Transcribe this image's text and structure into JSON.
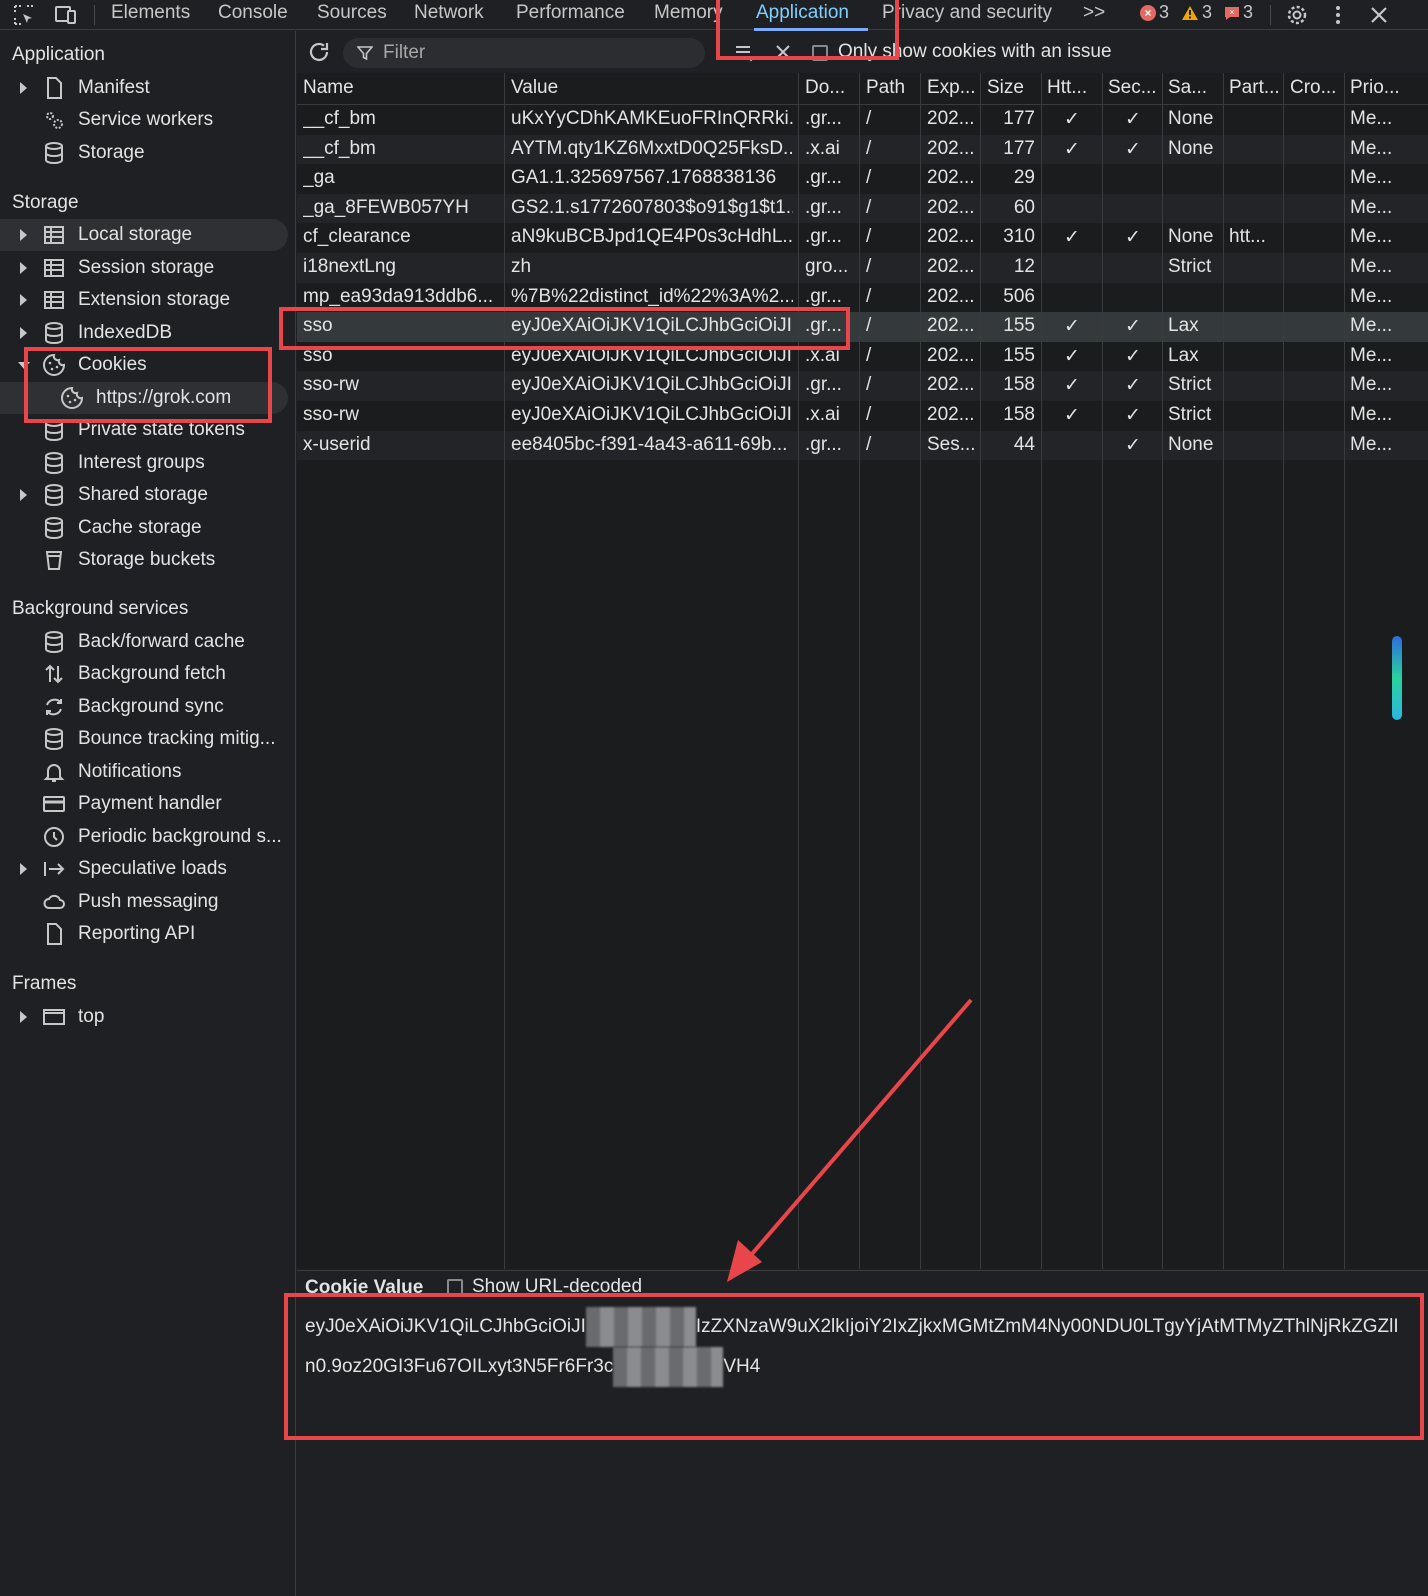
{
  "topbar": {
    "tabs": [
      "Elements",
      "Console",
      "Sources",
      "Network",
      "Performance",
      "Memory",
      "Application",
      "Privacy and security"
    ],
    "active_tab": "Application",
    "more": ">>",
    "errors": "3",
    "warnings": "3",
    "issues": "3"
  },
  "sidebar": {
    "application_header": "Application",
    "application_items": [
      "Manifest",
      "Service workers",
      "Storage"
    ],
    "storage_header": "Storage",
    "storage_items": [
      "Local storage",
      "Session storage",
      "Extension storage",
      "IndexedDB",
      "Cookies",
      "https://grok.com",
      "Private state tokens",
      "Interest groups",
      "Shared storage",
      "Cache storage",
      "Storage buckets"
    ],
    "background_header": "Background services",
    "background_items": [
      "Back/forward cache",
      "Background fetch",
      "Background sync",
      "Bounce tracking mitig...",
      "Notifications",
      "Payment handler",
      "Periodic background s...",
      "Speculative loads",
      "Push messaging",
      "Reporting API"
    ],
    "frames_header": "Frames",
    "frames_items": [
      "top"
    ]
  },
  "toolbar": {
    "filter_placeholder": "Filter",
    "only_issues_label": "Only show cookies with an issue"
  },
  "table": {
    "columns": [
      "Name",
      "Value",
      "Do...",
      "Path",
      "Exp...",
      "Size",
      "Htt...",
      "Sec...",
      "Sa...",
      "Part...",
      "Cro...",
      "Prio..."
    ],
    "rows": [
      [
        "__cf_bm",
        "uKxYyCDhKAMKEuoFRInQRRki...",
        ".gr...",
        "/",
        "202...",
        "177",
        "✓",
        "✓",
        "None",
        "",
        "",
        "Me..."
      ],
      [
        "__cf_bm",
        "AYTM.qty1KZ6MxxtD0Q25FksD...",
        ".x.ai",
        "/",
        "202...",
        "177",
        "✓",
        "✓",
        "None",
        "",
        "",
        "Me..."
      ],
      [
        "_ga",
        "GA1.1.325697567.1768838136",
        ".gr...",
        "/",
        "202...",
        "29",
        "",
        "",
        "",
        "",
        "",
        "Me..."
      ],
      [
        "_ga_8FEWB057YH",
        "GS2.1.s1772607803$o91$g1$t1...",
        ".gr...",
        "/",
        "202...",
        "60",
        "",
        "",
        "",
        "",
        "",
        "Me..."
      ],
      [
        "cf_clearance",
        "aN9kuBCBJpd1QE4P0s3cHdhL...",
        ".gr...",
        "/",
        "202...",
        "310",
        "✓",
        "✓",
        "None",
        "htt...",
        "",
        "Me..."
      ],
      [
        "i18nextLng",
        "zh",
        "gro...",
        "/",
        "202...",
        "12",
        "",
        "",
        "Strict",
        "",
        "",
        "Me..."
      ],
      [
        "mp_ea93da913ddb6...",
        "%7B%22distinct_id%22%3A%2...",
        ".gr...",
        "/",
        "202...",
        "506",
        "",
        "",
        "",
        "",
        "",
        "Me..."
      ],
      [
        "sso",
        "eyJ0eXAiOiJKV1QiLCJhbGciOiJI...",
        ".gr...",
        "/",
        "202...",
        "155",
        "✓",
        "✓",
        "Lax",
        "",
        "",
        "Me..."
      ],
      [
        "sso",
        "eyJ0eXAiOiJKV1QiLCJhbGciOiJI...",
        ".x.ai",
        "/",
        "202...",
        "155",
        "✓",
        "✓",
        "Lax",
        "",
        "",
        "Me..."
      ],
      [
        "sso-rw",
        "eyJ0eXAiOiJKV1QiLCJhbGciOiJI...",
        ".gr...",
        "/",
        "202...",
        "158",
        "✓",
        "✓",
        "Strict",
        "",
        "",
        "Me..."
      ],
      [
        "sso-rw",
        "eyJ0eXAiOiJKV1QiLCJhbGciOiJI...",
        ".x.ai",
        "/",
        "202...",
        "158",
        "✓",
        "✓",
        "Strict",
        "",
        "",
        "Me..."
      ],
      [
        "x-userid",
        "ee8405bc-f391-4a43-a611-69b...",
        ".gr...",
        "/",
        "Ses...",
        "44",
        "",
        "✓",
        "None",
        "",
        "",
        "Me..."
      ]
    ],
    "selected_row": 7
  },
  "cookie_value": {
    "title": "Cookie Value",
    "url_decoded_label": "Show URL-decoded",
    "value_part1": "eyJ0eXAiOiJKV1QiLCJhbGciOiJI",
    "value_part2": "IzZXNzaW9uX2lkIjoiY2IxZjkxMGMtZmM4Ny00NDU0LTgyYjAtMTMyZThlNjRkZGZlIn0.9",
    "value_part3": "oz20GI3Fu67OILxyt3N5Fr6Fr3c",
    "value_part4": "VH4"
  },
  "colors": {
    "accent": "#7fd0ff",
    "annotation": "#e9464c",
    "background": "#1f2023"
  }
}
